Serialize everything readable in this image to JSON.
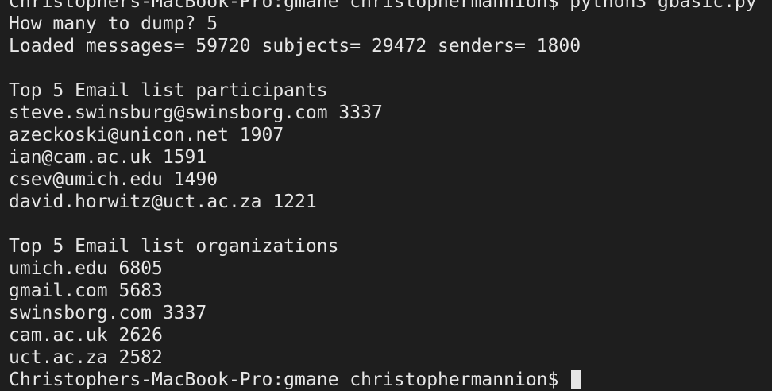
{
  "terminal": {
    "command_line": "Christophers-MacBook-Pro:gmane christophermannion$ python3 gbasic.py",
    "dump_prompt": "How many to dump? 5",
    "loaded": "Loaded messages= 59720 subjects= 29472 senders= 1800",
    "participants_header": "Top 5 Email list participants",
    "participants": [
      "steve.swinsburg@swinsborg.com 3337",
      "azeckoski@unicon.net 1907",
      "ian@cam.ac.uk 1591",
      "csev@umich.edu 1490",
      "david.horwitz@uct.ac.za 1221"
    ],
    "organizations_header": "Top 5 Email list organizations",
    "organizations": [
      "umich.edu 6805",
      "gmail.com 5683",
      "swinsborg.com 3337",
      "cam.ac.uk 2626",
      "uct.ac.za 2582"
    ],
    "final_prompt": "Christophers-MacBook-Pro:gmane christophermannion$ "
  }
}
